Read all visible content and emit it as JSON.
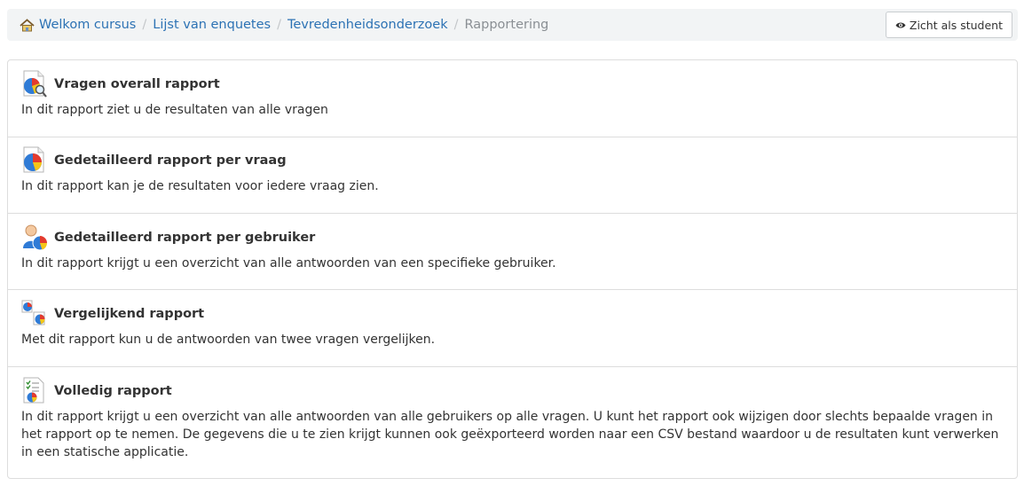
{
  "breadcrumb": {
    "items": [
      {
        "label": "Welkom cursus",
        "icon": "home-icon"
      },
      {
        "label": "Lijst van enquetes"
      },
      {
        "label": "Tevredenheidsonderzoek"
      }
    ],
    "current": "Rapportering",
    "separator": "/"
  },
  "toolbar": {
    "student_view_label": "Zicht als student",
    "student_view_icon": "eye-icon"
  },
  "reports": [
    {
      "title": "Vragen overall rapport",
      "description": "In dit rapport ziet u de resultaten van alle vragen",
      "icon": "pie-chart-search-icon"
    },
    {
      "title": "Gedetailleerd rapport per vraag",
      "description": "In dit rapport kan je de resultaten voor iedere vraag zien.",
      "icon": "pie-chart-document-icon"
    },
    {
      "title": "Gedetailleerd rapport per gebruiker",
      "description": "In dit rapport krijgt u een overzicht van alle antwoorden van een specifieke gebruiker.",
      "icon": "user-pie-chart-icon"
    },
    {
      "title": "Vergelijkend rapport",
      "description": "Met dit rapport kun u de antwoorden van twee vragen vergelijken.",
      "icon": "compare-pie-charts-icon"
    },
    {
      "title": "Volledig rapport",
      "description": "In dit rapport krijgt u een overzicht van alle antwoorden van alle gebruikers op alle vragen. U kunt het rapport ook wijzigen door slechts bepaalde vragen in het rapport op te nemen. De gegevens die u te zien krijgt kunnen ook geëxporteerd worden naar een CSV bestand waardoor u de resultaten kunt verwerken in een statische applicatie.",
      "icon": "checklist-report-icon"
    }
  ]
}
